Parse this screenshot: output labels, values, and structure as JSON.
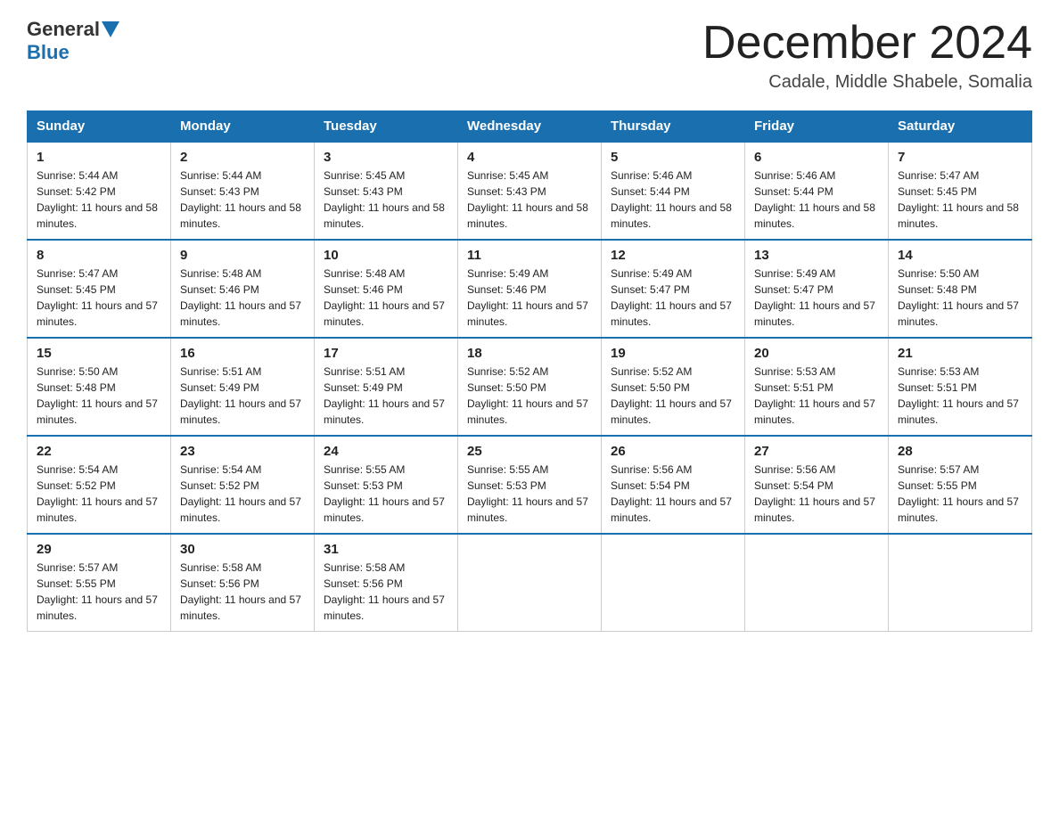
{
  "logo": {
    "general": "General",
    "blue": "Blue"
  },
  "title": "December 2024",
  "subtitle": "Cadale, Middle Shabele, Somalia",
  "headers": [
    "Sunday",
    "Monday",
    "Tuesday",
    "Wednesday",
    "Thursday",
    "Friday",
    "Saturday"
  ],
  "weeks": [
    [
      {
        "day": "1",
        "sunrise": "5:44 AM",
        "sunset": "5:42 PM",
        "daylight": "11 hours and 58 minutes."
      },
      {
        "day": "2",
        "sunrise": "5:44 AM",
        "sunset": "5:43 PM",
        "daylight": "11 hours and 58 minutes."
      },
      {
        "day": "3",
        "sunrise": "5:45 AM",
        "sunset": "5:43 PM",
        "daylight": "11 hours and 58 minutes."
      },
      {
        "day": "4",
        "sunrise": "5:45 AM",
        "sunset": "5:43 PM",
        "daylight": "11 hours and 58 minutes."
      },
      {
        "day": "5",
        "sunrise": "5:46 AM",
        "sunset": "5:44 PM",
        "daylight": "11 hours and 58 minutes."
      },
      {
        "day": "6",
        "sunrise": "5:46 AM",
        "sunset": "5:44 PM",
        "daylight": "11 hours and 58 minutes."
      },
      {
        "day": "7",
        "sunrise": "5:47 AM",
        "sunset": "5:45 PM",
        "daylight": "11 hours and 58 minutes."
      }
    ],
    [
      {
        "day": "8",
        "sunrise": "5:47 AM",
        "sunset": "5:45 PM",
        "daylight": "11 hours and 57 minutes."
      },
      {
        "day": "9",
        "sunrise": "5:48 AM",
        "sunset": "5:46 PM",
        "daylight": "11 hours and 57 minutes."
      },
      {
        "day": "10",
        "sunrise": "5:48 AM",
        "sunset": "5:46 PM",
        "daylight": "11 hours and 57 minutes."
      },
      {
        "day": "11",
        "sunrise": "5:49 AM",
        "sunset": "5:46 PM",
        "daylight": "11 hours and 57 minutes."
      },
      {
        "day": "12",
        "sunrise": "5:49 AM",
        "sunset": "5:47 PM",
        "daylight": "11 hours and 57 minutes."
      },
      {
        "day": "13",
        "sunrise": "5:49 AM",
        "sunset": "5:47 PM",
        "daylight": "11 hours and 57 minutes."
      },
      {
        "day": "14",
        "sunrise": "5:50 AM",
        "sunset": "5:48 PM",
        "daylight": "11 hours and 57 minutes."
      }
    ],
    [
      {
        "day": "15",
        "sunrise": "5:50 AM",
        "sunset": "5:48 PM",
        "daylight": "11 hours and 57 minutes."
      },
      {
        "day": "16",
        "sunrise": "5:51 AM",
        "sunset": "5:49 PM",
        "daylight": "11 hours and 57 minutes."
      },
      {
        "day": "17",
        "sunrise": "5:51 AM",
        "sunset": "5:49 PM",
        "daylight": "11 hours and 57 minutes."
      },
      {
        "day": "18",
        "sunrise": "5:52 AM",
        "sunset": "5:50 PM",
        "daylight": "11 hours and 57 minutes."
      },
      {
        "day": "19",
        "sunrise": "5:52 AM",
        "sunset": "5:50 PM",
        "daylight": "11 hours and 57 minutes."
      },
      {
        "day": "20",
        "sunrise": "5:53 AM",
        "sunset": "5:51 PM",
        "daylight": "11 hours and 57 minutes."
      },
      {
        "day": "21",
        "sunrise": "5:53 AM",
        "sunset": "5:51 PM",
        "daylight": "11 hours and 57 minutes."
      }
    ],
    [
      {
        "day": "22",
        "sunrise": "5:54 AM",
        "sunset": "5:52 PM",
        "daylight": "11 hours and 57 minutes."
      },
      {
        "day": "23",
        "sunrise": "5:54 AM",
        "sunset": "5:52 PM",
        "daylight": "11 hours and 57 minutes."
      },
      {
        "day": "24",
        "sunrise": "5:55 AM",
        "sunset": "5:53 PM",
        "daylight": "11 hours and 57 minutes."
      },
      {
        "day": "25",
        "sunrise": "5:55 AM",
        "sunset": "5:53 PM",
        "daylight": "11 hours and 57 minutes."
      },
      {
        "day": "26",
        "sunrise": "5:56 AM",
        "sunset": "5:54 PM",
        "daylight": "11 hours and 57 minutes."
      },
      {
        "day": "27",
        "sunrise": "5:56 AM",
        "sunset": "5:54 PM",
        "daylight": "11 hours and 57 minutes."
      },
      {
        "day": "28",
        "sunrise": "5:57 AM",
        "sunset": "5:55 PM",
        "daylight": "11 hours and 57 minutes."
      }
    ],
    [
      {
        "day": "29",
        "sunrise": "5:57 AM",
        "sunset": "5:55 PM",
        "daylight": "11 hours and 57 minutes."
      },
      {
        "day": "30",
        "sunrise": "5:58 AM",
        "sunset": "5:56 PM",
        "daylight": "11 hours and 57 minutes."
      },
      {
        "day": "31",
        "sunrise": "5:58 AM",
        "sunset": "5:56 PM",
        "daylight": "11 hours and 57 minutes."
      },
      null,
      null,
      null,
      null
    ]
  ]
}
